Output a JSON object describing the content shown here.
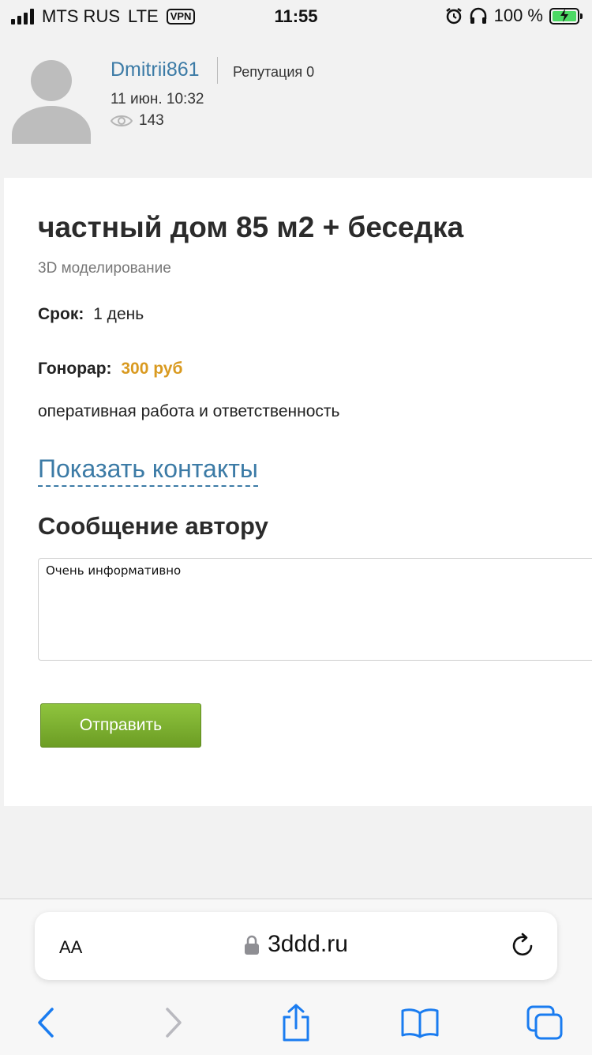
{
  "status_bar": {
    "carrier": "MTS RUS",
    "network": "LTE",
    "vpn": "VPN",
    "time": "11:55",
    "battery": "100 %"
  },
  "author": {
    "name": "Dmitrii861",
    "reputation": "Репутация 0",
    "date": "11 июн. 10:32",
    "views": "143"
  },
  "post": {
    "title": "частный дом 85 м2 + беседка",
    "category": "3D моделирование",
    "term_label": "Срок:",
    "term_value": "1 день",
    "fee_label": "Гонорар:",
    "fee_value": "300 руб",
    "description": "оперативная работа и ответственность",
    "show_contacts": "Показать контакты"
  },
  "message": {
    "title": "Сообщение автору",
    "value": "Очень информативно",
    "send_label": "Отправить"
  },
  "browser": {
    "text_size": "AA",
    "url": "3ddd.ru"
  },
  "colors": {
    "link": "#3c7ba6",
    "fee": "#d99a20",
    "button": "#7bb02e",
    "ios_blue": "#1a7cf0"
  }
}
